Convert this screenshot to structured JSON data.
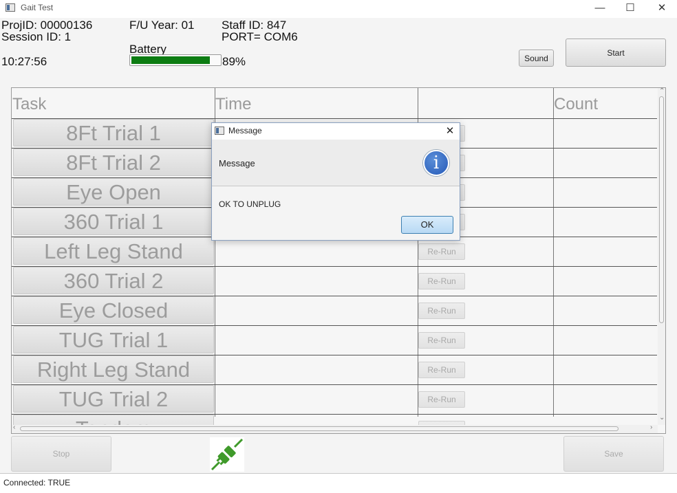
{
  "window": {
    "title": "Gait Test",
    "minimize": "—",
    "maximize": "☐",
    "close": "✕"
  },
  "header": {
    "proj_id": "ProjID: 00000136",
    "session_id": "Session ID: 1",
    "fu_year": "F/U Year: 01",
    "staff_id": "Staff ID: 847",
    "port": "PORT= COM6",
    "time": "10:27:56",
    "battery_label": "Battery",
    "battery_percent": "89%",
    "battery_level": 0.89,
    "sound_label": "Sound",
    "start_label": "Start"
  },
  "table": {
    "columns": [
      "Task",
      "Time",
      "",
      "Count"
    ],
    "rows": [
      {
        "task": "8Ft Trial 1",
        "rerun": "Re-Run"
      },
      {
        "task": "8Ft Trial 2",
        "rerun": "Re-Run"
      },
      {
        "task": "Eye Open",
        "rerun": "Re-Run"
      },
      {
        "task": "360 Trial 1",
        "rerun": "Re-Run"
      },
      {
        "task": "Left Leg Stand",
        "rerun": "Re-Run"
      },
      {
        "task": "360 Trial 2",
        "rerun": "Re-Run"
      },
      {
        "task": "Eye Closed",
        "rerun": "Re-Run"
      },
      {
        "task": "TUG Trial 1",
        "rerun": "Re-Run"
      },
      {
        "task": "Right Leg Stand",
        "rerun": "Re-Run"
      },
      {
        "task": "TUG Trial 2",
        "rerun": "Re-Run"
      },
      {
        "task": "Tandem",
        "rerun": "Re-Run"
      }
    ]
  },
  "bottom": {
    "stop_label": "Stop",
    "save_label": "Save",
    "plug_icon": "plug-icon"
  },
  "status": {
    "text": "Connected: TRUE"
  },
  "dialog": {
    "title": "Message",
    "header_text": "Message",
    "content": "OK TO UNPLUG",
    "ok_label": "OK",
    "icon_glyph": "i"
  },
  "colors": {
    "battery_fill": "#0c7c12",
    "plug_green": "#3f9a2a",
    "info_blue": "#2f63c0"
  }
}
